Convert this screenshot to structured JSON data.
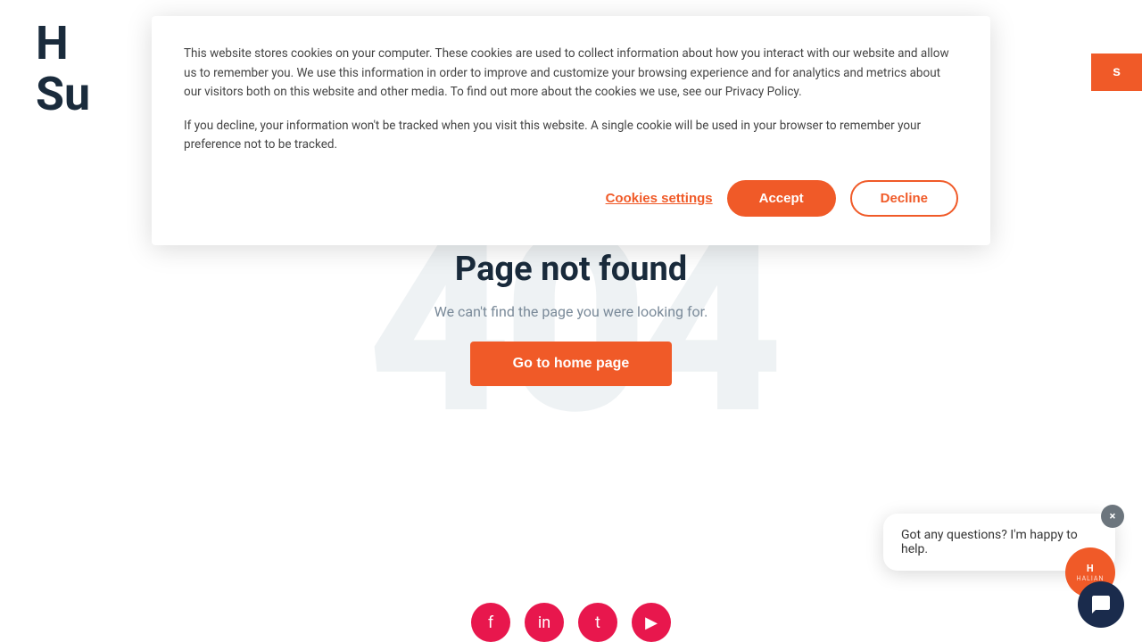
{
  "header": {
    "title_line1": "H",
    "title_line2": "Su",
    "button_label": "s"
  },
  "cookie_banner": {
    "text1": "This website stores cookies on your computer. These cookies are used to collect information about how you interact with our website and allow us to remember you. We use this information in order to improve and customize your browsing experience and for analytics and metrics about our visitors both on this website and other media. To find out more about the cookies we use, see our Privacy Policy.",
    "text2": "If you decline, your information won't be tracked when you visit this website. A single cookie will be used in your browser to remember your preference not to be tracked.",
    "cookies_settings_label": "Cookies settings",
    "accept_label": "Accept",
    "decline_label": "Decline"
  },
  "error_page": {
    "bg_text": "404",
    "title": "Page not found",
    "subtitle": "We can't find the page you were looking for.",
    "home_button_label": "Go to home page"
  },
  "chat": {
    "avatar_text": "H",
    "avatar_sub": "HALIAN",
    "bubble_text": "Got any questions? I'm happy to help.",
    "close_icon": "×"
  },
  "social": {
    "icons": [
      "f",
      "in",
      "t",
      "y"
    ]
  },
  "colors": {
    "accent": "#f05a28",
    "dark": "#1a2b3c",
    "light_gray": "#e8edf0",
    "text_gray": "#7a8a99"
  }
}
